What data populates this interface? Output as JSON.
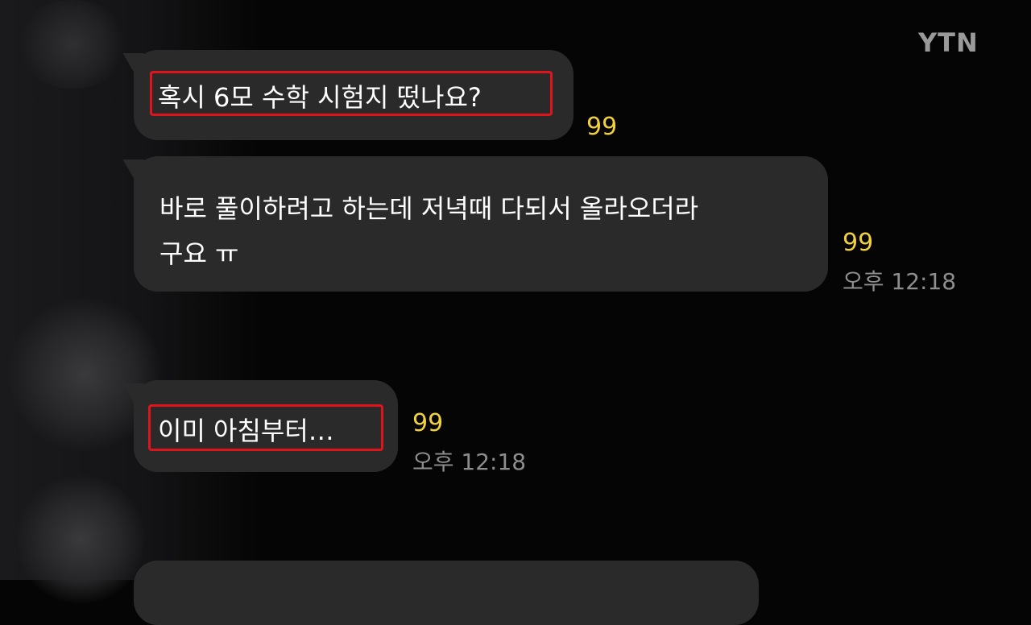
{
  "brand": {
    "logo": "YTN"
  },
  "messages": [
    {
      "text": "혹시 6모 수학 시험지 떴나요?",
      "unread": "99",
      "time": ""
    },
    {
      "line1": "바로 풀이하려고 하는데 저녁때 다되서 올라오더라",
      "line2": "구요 ㅠ",
      "unread": "99",
      "time": "오후 12:18"
    },
    {
      "text": "이미 아침부터…",
      "unread": "99",
      "time": "오후 12:18"
    }
  ],
  "colors": {
    "highlight": "#e0141c",
    "unread": "#f0d13a",
    "bubble": "#2a2a2b"
  }
}
